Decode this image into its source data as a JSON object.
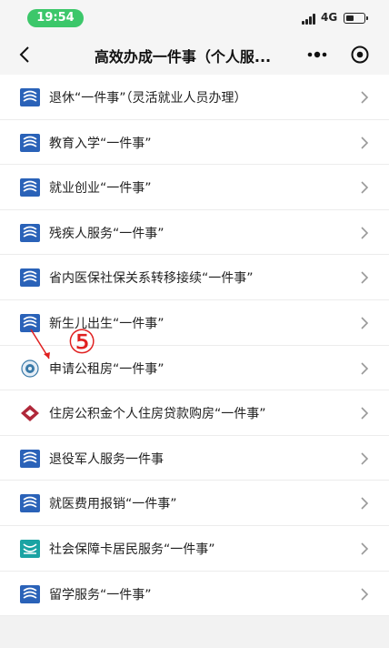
{
  "status": {
    "time": "19:54",
    "network": "4G"
  },
  "navbar": {
    "title": "高效办成一件事（个人服..."
  },
  "items": [
    {
      "label": "退休“一件事”（灵活就业人员办理）",
      "icon": "hrss-logo-icon"
    },
    {
      "label": "教育入学“一件事”",
      "icon": "hrss-logo-icon"
    },
    {
      "label": "就业创业“一件事”",
      "icon": "hrss-logo-icon"
    },
    {
      "label": "残疾人服务“一件事”",
      "icon": "hrss-logo-icon"
    },
    {
      "label": "省内医保社保关系转移接续“一件事”",
      "icon": "hrss-logo-icon"
    },
    {
      "label": "新生儿出生“一件事”",
      "icon": "hrss-logo-icon"
    },
    {
      "label": "申请公租房“一件事”",
      "icon": "housing-seal-icon"
    },
    {
      "label": "住房公积金个人住房贷款购房“一件事”",
      "icon": "housing-fund-icon"
    },
    {
      "label": "退役军人服务一件事",
      "icon": "hrss-logo-icon"
    },
    {
      "label": "就医费用报销“一件事”",
      "icon": "hrss-logo-icon"
    },
    {
      "label": "社会保障卡居民服务“一件事”",
      "icon": "social-card-icon"
    },
    {
      "label": "留学服务“一件事”",
      "icon": "hrss-logo-icon"
    }
  ],
  "annotation": {
    "label": "⑤",
    "color": "#e02020"
  },
  "colors": {
    "accent": "#3cc76a",
    "icon_blue": "#2a62b8",
    "icon_teal": "#1aa3a3",
    "fund_red": "#b0283a"
  }
}
